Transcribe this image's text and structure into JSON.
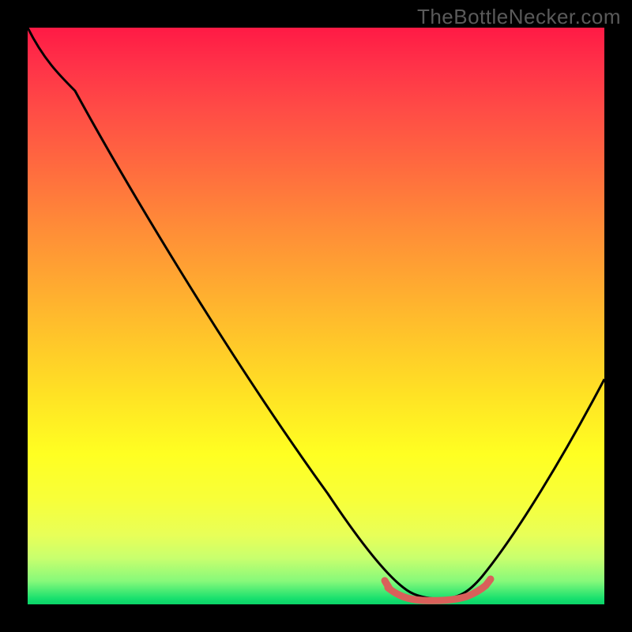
{
  "watermark": "TheBottleNecker.com",
  "chart_data": {
    "type": "line",
    "title": "",
    "xlabel": "",
    "ylabel": "",
    "xlim": [
      0,
      100
    ],
    "ylim": [
      0,
      100
    ],
    "series": [
      {
        "name": "bottleneck-curve",
        "x": [
          0,
          5,
          10,
          15,
          20,
          25,
          30,
          35,
          40,
          45,
          50,
          55,
          60,
          62,
          64,
          66,
          68,
          70,
          72,
          74,
          76,
          80,
          85,
          90,
          95,
          100
        ],
        "values": [
          100,
          96,
          90,
          83,
          76,
          69,
          62,
          55,
          48,
          41,
          34,
          27,
          19,
          15,
          11,
          7,
          4,
          2,
          1.2,
          1.0,
          1.3,
          3,
          9,
          18,
          28,
          40
        ]
      },
      {
        "name": "highlight-segment",
        "x": [
          62,
          64,
          66,
          68,
          70,
          72,
          74,
          76,
          78
        ],
        "values": [
          2.8,
          2.0,
          1.5,
          1.2,
          1.1,
          1.2,
          1.5,
          2.2,
          3.2
        ]
      }
    ],
    "colors": {
      "curve": "#000000",
      "highlight": "#d9605a",
      "gradient_top": "#ff1a45",
      "gradient_bottom": "#0ad268"
    }
  }
}
